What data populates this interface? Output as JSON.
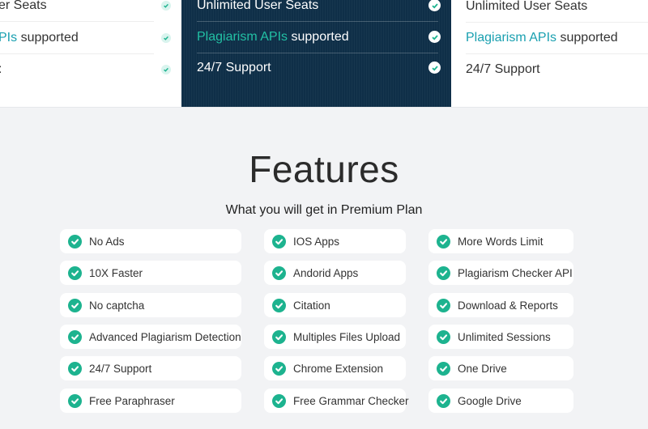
{
  "pricing": {
    "left_card": {
      "rows": [
        {
          "text": "er Seats"
        },
        {
          "highlight": "PIs",
          "text": " supported"
        },
        {
          "text": ":"
        }
      ]
    },
    "middle_card": {
      "rows": [
        {
          "text": "Unlimited User Seats"
        },
        {
          "highlight": "Plagiarism APIs",
          "text": " supported"
        },
        {
          "text": "24/7 Support"
        }
      ]
    },
    "right_card": {
      "rows": [
        {
          "text": "Unlimited User Seats"
        },
        {
          "highlight": "Plagiarism APIs",
          "text": " supported"
        },
        {
          "text": "24/7 Support"
        }
      ]
    }
  },
  "features": {
    "title": "Features",
    "subtitle": "What you will get in Premium Plan",
    "columns": [
      [
        "No Ads",
        "10X Faster",
        "No captcha",
        "Advanced Plagiarism Detection",
        "24/7 Support",
        "Free Paraphraser"
      ],
      [
        "IOS Apps",
        "Andorid Apps",
        "Citation",
        "Multiples Files Upload",
        "Chrome Extension",
        "Free Grammar Checker"
      ],
      [
        "More Words Limit",
        "Plagiarism Checker API",
        "Download & Reports",
        "Unlimited Sessions",
        "One Drive",
        "Google Drive"
      ]
    ]
  },
  "colors": {
    "dark_card": "#0f2f48",
    "accent_green": "#1db38f",
    "link_teal": "#1aa0b0"
  },
  "icons": {
    "check": "check-circle-icon"
  }
}
